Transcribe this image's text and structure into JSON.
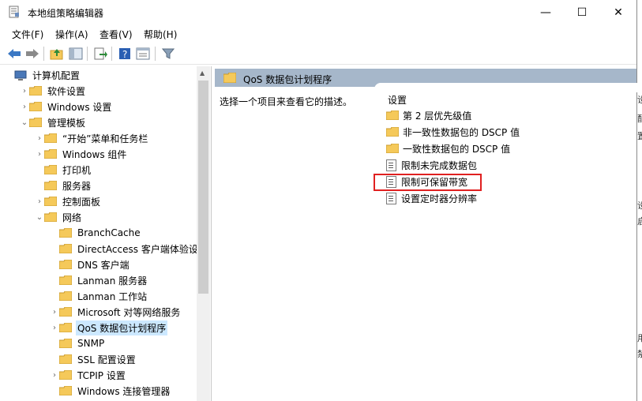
{
  "window": {
    "title": "本地组策略编辑器",
    "minimize": "—",
    "maximize": "☐",
    "close": "✕"
  },
  "menu": [
    "文件(F)",
    "操作(A)",
    "查看(V)",
    "帮助(H)"
  ],
  "toolbar": [
    "back-arrow-icon",
    "forward-arrow-icon",
    "up-folder-icon",
    "show-tree-icon",
    "export-icon",
    "help-icon",
    "properties-icon",
    "filter-icon"
  ],
  "tree": [
    {
      "label": "计算机配置",
      "indent": 0,
      "chev": "",
      "icon": "computer"
    },
    {
      "label": "软件设置",
      "indent": 1,
      "chev": "›",
      "icon": "folder"
    },
    {
      "label": "Windows 设置",
      "indent": 1,
      "chev": "›",
      "icon": "folder"
    },
    {
      "label": "管理模板",
      "indent": 1,
      "chev": "⌄",
      "icon": "folder"
    },
    {
      "label": "“开始”菜单和任务栏",
      "indent": 2,
      "chev": "›",
      "icon": "folder"
    },
    {
      "label": "Windows 组件",
      "indent": 2,
      "chev": "›",
      "icon": "folder"
    },
    {
      "label": "打印机",
      "indent": 2,
      "chev": "",
      "icon": "folder"
    },
    {
      "label": "服务器",
      "indent": 2,
      "chev": "",
      "icon": "folder"
    },
    {
      "label": "控制面板",
      "indent": 2,
      "chev": "›",
      "icon": "folder"
    },
    {
      "label": "网络",
      "indent": 2,
      "chev": "⌄",
      "icon": "folder"
    },
    {
      "label": "BranchCache",
      "indent": 3,
      "chev": "",
      "icon": "folder"
    },
    {
      "label": "DirectAccess 客户端体验设置",
      "indent": 3,
      "chev": "",
      "icon": "folder"
    },
    {
      "label": "DNS 客户端",
      "indent": 3,
      "chev": "",
      "icon": "folder"
    },
    {
      "label": "Lanman 服务器",
      "indent": 3,
      "chev": "",
      "icon": "folder"
    },
    {
      "label": "Lanman 工作站",
      "indent": 3,
      "chev": "",
      "icon": "folder"
    },
    {
      "label": "Microsoft 对等网络服务",
      "indent": 3,
      "chev": "›",
      "icon": "folder"
    },
    {
      "label": "QoS 数据包计划程序",
      "indent": 3,
      "chev": "›",
      "icon": "folder",
      "selected": true
    },
    {
      "label": "SNMP",
      "indent": 3,
      "chev": "",
      "icon": "folder"
    },
    {
      "label": "SSL 配置设置",
      "indent": 3,
      "chev": "",
      "icon": "folder"
    },
    {
      "label": "TCPIP 设置",
      "indent": 3,
      "chev": "›",
      "icon": "folder"
    },
    {
      "label": "Windows 连接管理器",
      "indent": 3,
      "chev": "",
      "icon": "folder"
    }
  ],
  "right": {
    "header": "QoS 数据包计划程序",
    "description": "选择一个项目来查看它的描述。",
    "settings_header": "设置",
    "settings": [
      {
        "label": "第 2 层优先级值",
        "type": "folder"
      },
      {
        "label": "非一致性数据包的 DSCP 值",
        "type": "folder"
      },
      {
        "label": "一致性数据包的 DSCP 值",
        "type": "folder"
      },
      {
        "label": "限制未完成数据包",
        "type": "policy"
      },
      {
        "label": "限制可保留带宽",
        "type": "policy",
        "highlighted": true
      },
      {
        "label": "设置定时器分辨率",
        "type": "policy"
      }
    ]
  },
  "edge": [
    "设",
    "配",
    "置",
    "设",
    "启",
    "用",
    "禁"
  ],
  "colors": {
    "header_bg": "#a6b7ca",
    "selection": "#cce8ff",
    "highlight": "#e02020",
    "folder": "#f5c95a"
  }
}
